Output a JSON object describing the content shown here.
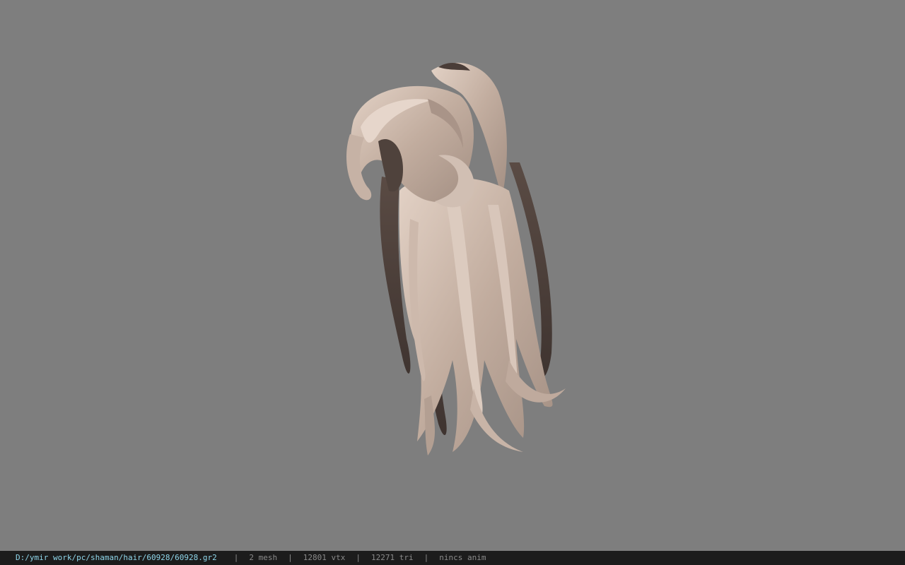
{
  "viewer": {
    "background_color": "#7e7e7e",
    "model": {
      "hair_light": "#d6c3b6",
      "hair_mid": "#b59e91",
      "hair_dark": "#4a3d38"
    }
  },
  "status": {
    "file_path": "D:/ymir work/pc/shaman/hair/60928/60928.gr2",
    "separator": "|",
    "mesh": "2 mesh",
    "vertices": "12801 vtx",
    "triangles": "12271 tri",
    "animation": "nincs anim"
  }
}
